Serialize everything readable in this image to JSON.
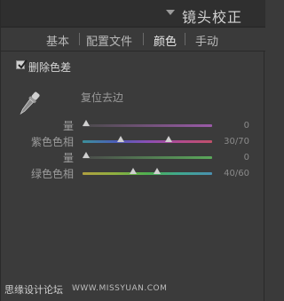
{
  "header": {
    "title": "镜头校正"
  },
  "tabs": [
    {
      "label": "基本",
      "active": false
    },
    {
      "label": "配置文件",
      "active": false
    },
    {
      "label": "颜色",
      "active": true
    },
    {
      "label": "手动",
      "active": false
    }
  ],
  "defringe": {
    "checkbox_label": "删除色差",
    "checked": true,
    "reset_label": "复位去边",
    "sliders": [
      {
        "label": "量",
        "value": "0",
        "thumbs": [
          0
        ],
        "track": "purple"
      },
      {
        "label": "紫色色相",
        "value": "30/70",
        "thumbs": [
          30,
          70
        ],
        "track": "purple-hue"
      },
      {
        "label": "量",
        "value": "0",
        "thumbs": [
          0
        ],
        "track": "green"
      },
      {
        "label": "绿色色相",
        "value": "40/60",
        "thumbs": [
          40,
          60
        ],
        "track": "green-hue"
      }
    ]
  },
  "watermark": {
    "cn": "思缘设计论坛",
    "en": "WWW.MISSYUAN.COM"
  },
  "colors": {
    "panel_bg": "#3b3b3b",
    "header_bg": "#2f2f2f",
    "active_tab": "#e8e8e8"
  }
}
